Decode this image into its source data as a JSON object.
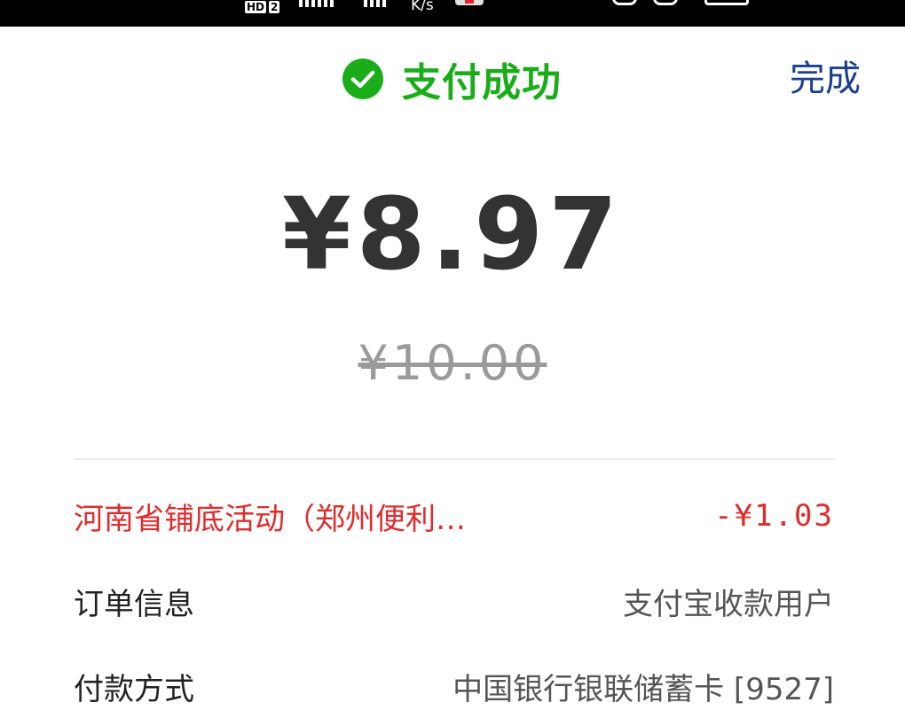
{
  "status_bar": {
    "hd_label": "HD",
    "sim_label": "2",
    "speed_unit": "K/s"
  },
  "header": {
    "title": "支付成功",
    "done_label": "完成",
    "title_color": "#1aad19",
    "done_color": "#1a3f8c"
  },
  "payment": {
    "amount": "¥8.97",
    "original_amount": "¥10.00"
  },
  "details": {
    "promotion": {
      "label": "河南省铺底活动（郑州便利…",
      "value": "-¥1.03",
      "color": "#e02b2b"
    },
    "order_info": {
      "label": "订单信息",
      "value": "支付宝收款用户"
    },
    "payment_method": {
      "label": "付款方式",
      "value": "中国银行银联储蓄卡 [9527]"
    }
  },
  "icons": {
    "success": "check-circle-icon"
  }
}
